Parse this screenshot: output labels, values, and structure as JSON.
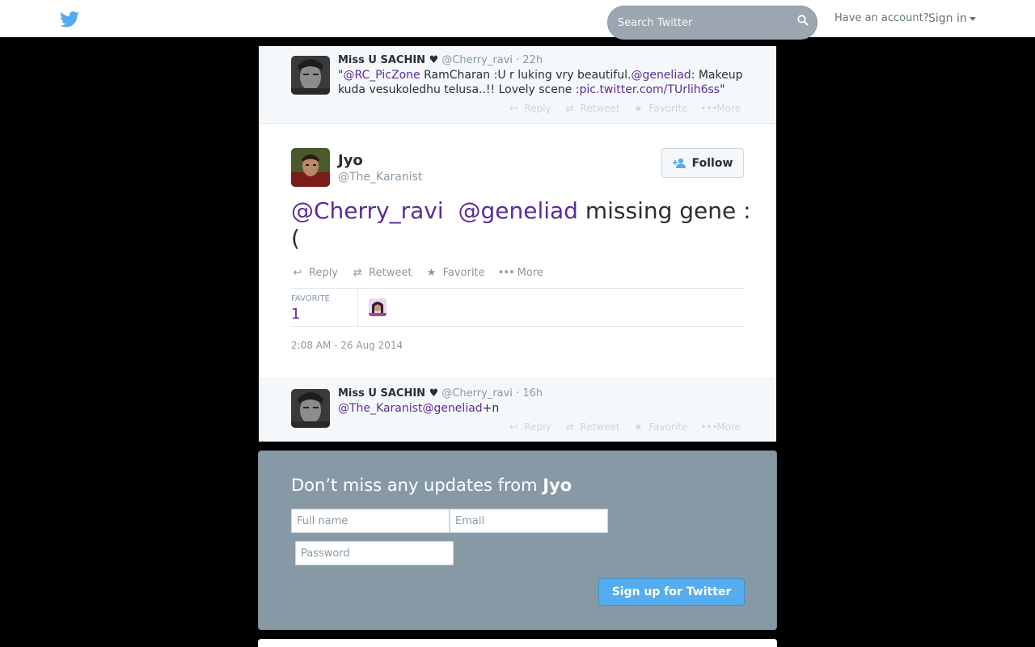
{
  "topbar": {
    "search_placeholder": "Search Twitter",
    "have_account": "Have an account?",
    "sign_in": "Sign in"
  },
  "ancestor_tweet": {
    "name": "Miss U SACHIN ♥",
    "handle": "@Cherry_ravi",
    "time": "· 22h",
    "text_parts": [
      "\"",
      "@RC_PicZone",
      " RamCharan :U r luking vry beautiful.",
      "@geneliad",
      ": Makeup kuda vesukoledhu telusa..!! Lovely scene :",
      "pic.twitter.com/TUrlih6ss",
      "\""
    ]
  },
  "main_tweet": {
    "name": "Jyo",
    "handle": "@The_Karanist",
    "follow_label": "Follow",
    "mention1": "@Cherry_ravi",
    "mention2": "@geneliad",
    "rest_text": " missing gene :(",
    "favorite_label": "FAVORITE",
    "favorite_count": "1",
    "timestamp": "2:08 AM - 26 Aug 2014"
  },
  "actions": {
    "reply": "Reply",
    "retweet": "Retweet",
    "favorite": "Favorite",
    "more": "More"
  },
  "reply_tweet": {
    "name": "Miss U SACHIN ♥",
    "handle": "@Cherry_ravi",
    "time": "· 16h",
    "mention1": "@The_Karanist",
    "mention2": "@geneliad",
    "rest_text": "+n"
  },
  "signup": {
    "heading_prefix": "Don’t miss any updates from ",
    "heading_name": "Jyo",
    "fullname_placeholder": "Full name",
    "email_placeholder": "Email",
    "password_placeholder": "Password",
    "button": "Sign up for Twitter"
  },
  "icons": {
    "logo": "twitter-bird-icon",
    "search": "search-icon",
    "reply": "reply-icon",
    "retweet": "retweet-icon",
    "favorite": "star-icon",
    "more": "more-dots-icon",
    "follow": "add-user-icon"
  },
  "colors": {
    "brand": "#55acee",
    "mention": "#5b2c9a",
    "signup_bg": "#8899a6"
  }
}
